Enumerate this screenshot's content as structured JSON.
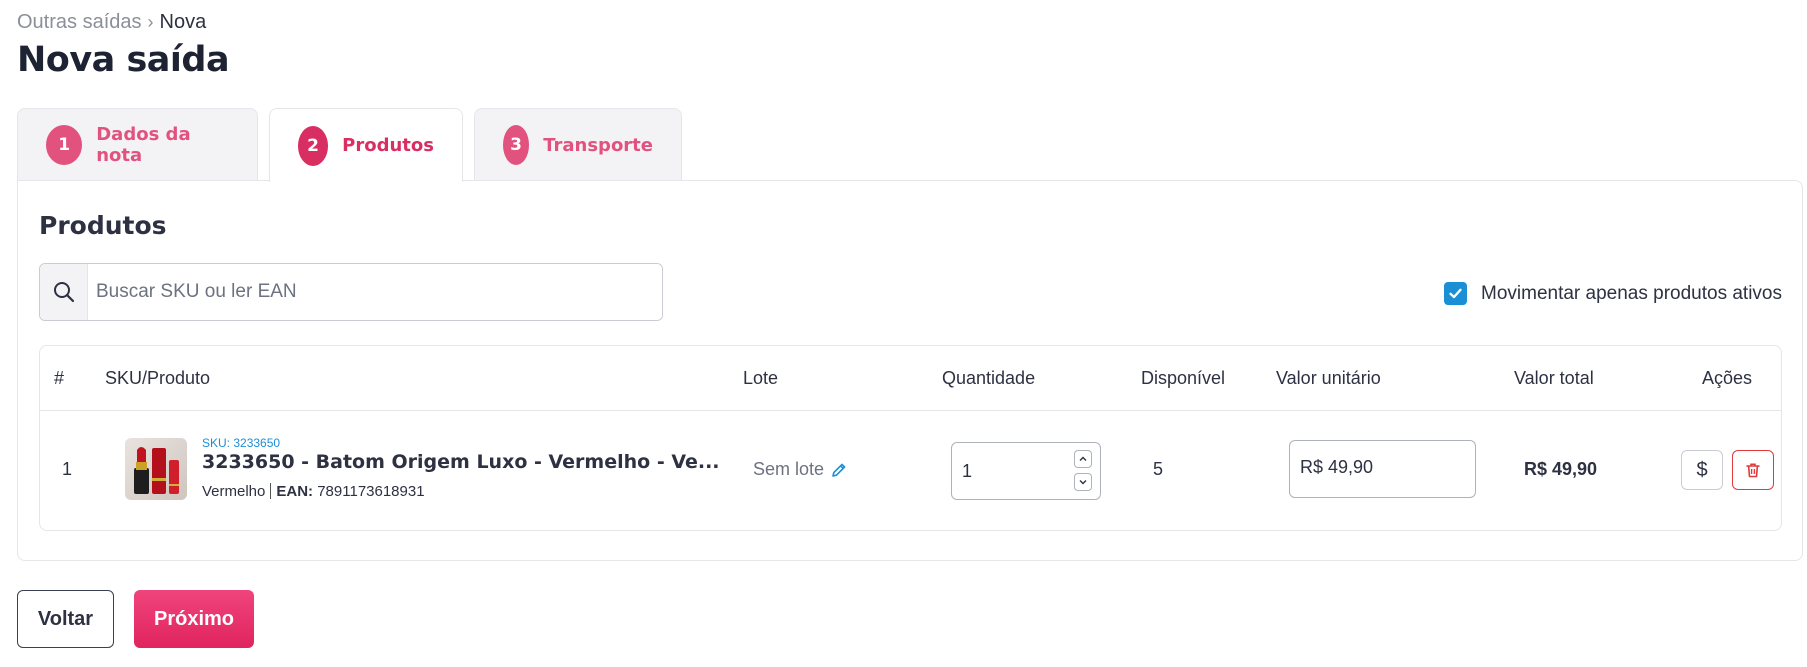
{
  "breadcrumb": {
    "parent": "Outras saídas",
    "separator": "›",
    "current": "Nova"
  },
  "page_title": "Nova saída",
  "tabs": [
    {
      "number": "1",
      "label": "Dados da nota",
      "active": false
    },
    {
      "number": "2",
      "label": "Produtos",
      "active": true
    },
    {
      "number": "3",
      "label": "Transporte",
      "active": false
    }
  ],
  "products": {
    "title": "Produtos",
    "search": {
      "placeholder": "Buscar SKU ou ler EAN",
      "value": "",
      "icon": "search-icon"
    },
    "active_only": {
      "label": "Movimentar apenas produtos ativos",
      "checked": true
    }
  },
  "table": {
    "headers": {
      "index": "#",
      "sku_product": "SKU/Produto",
      "lote": "Lote",
      "quantidade": "Quantidade",
      "disponivel": "Disponível",
      "valor_unitario": "Valor unitário",
      "valor_total": "Valor total",
      "acoes": "Ações"
    },
    "rows": [
      {
        "index": "1",
        "sku_label": "SKU: 3233650",
        "name": "3233650 - Batom Origem Luxo - Vermelho - Ve...",
        "variant": "Vermelho",
        "ean_label": "EAN:",
        "ean": "7891173618931",
        "lote": "Sem lote",
        "quantidade": "1",
        "disponivel": "5",
        "valor_unitario": "R$ 49,90",
        "valor_total": "R$ 49,90",
        "price_action": "$"
      }
    ]
  },
  "footer": {
    "back_label": "Voltar",
    "next_label": "Próximo"
  },
  "colors": {
    "accent": "#e0245f",
    "tab_accent": "#e2527f",
    "link": "#1b8fd6",
    "danger": "#e03a3a"
  }
}
